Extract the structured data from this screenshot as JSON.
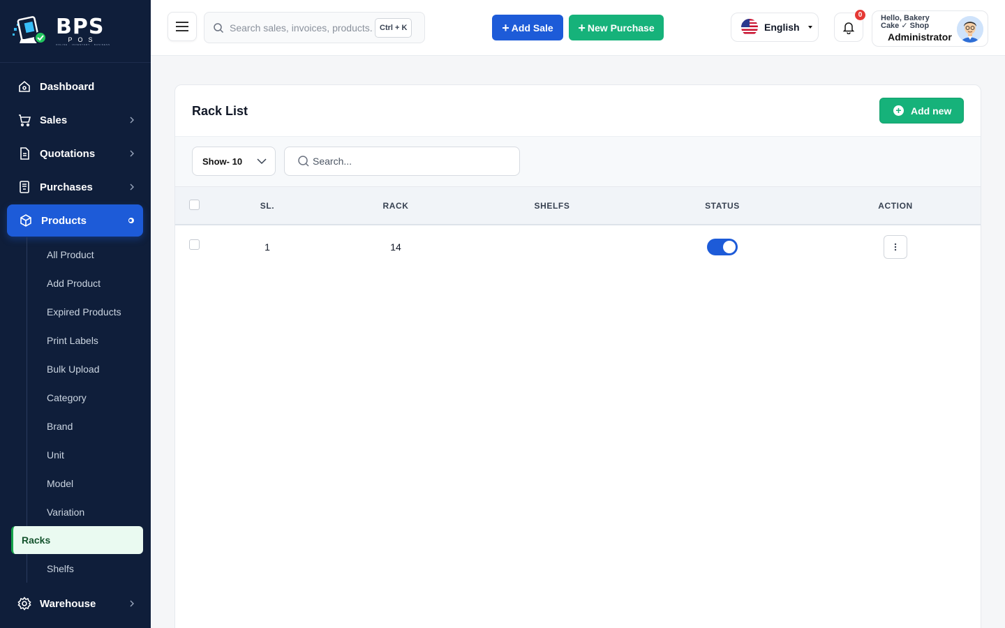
{
  "brand": {
    "name": "BPS",
    "sub": "POS",
    "tagline": "ONLINE · INVENTORY · BUSINESS"
  },
  "sidebar": {
    "items": [
      {
        "label": "Dashboard",
        "icon": "home-icon"
      },
      {
        "label": "Sales",
        "icon": "cart-icon"
      },
      {
        "label": "Quotations",
        "icon": "document-icon"
      },
      {
        "label": "Purchases",
        "icon": "receipt-icon"
      },
      {
        "label": "Products",
        "icon": "box-icon"
      }
    ],
    "products_sub": [
      "All Product",
      "Add Product",
      "Expired Products",
      "Print Labels",
      "Bulk Upload",
      "Category",
      "Brand",
      "Unit",
      "Model",
      "Variation",
      "Racks",
      "Shelfs"
    ],
    "bottom": {
      "label": "Warehouse",
      "icon": "settings-icon"
    }
  },
  "header": {
    "search_placeholder": "Search sales, invoices, products...",
    "shortcut": "Ctrl + K",
    "add_sale": "Add Sale",
    "new_purchase": "New Purchase",
    "language": "English",
    "notif_count": "0",
    "user_hello": "Hello, Bakery Cake ✓ Shop",
    "user_role": "Administrator"
  },
  "page": {
    "title": "Rack List",
    "add_new": "Add new",
    "show": "Show- 10",
    "search_placeholder": "Search...",
    "columns": [
      "SL.",
      "RACK",
      "SHELFS",
      "STATUS",
      "ACTION"
    ],
    "rows": [
      {
        "sl": "1",
        "rack": "14",
        "shelfs": "",
        "status": true
      }
    ]
  },
  "colors": {
    "sidebar": "#0f1e3a",
    "primary": "#1d5bd8",
    "success": "#16b27a"
  }
}
